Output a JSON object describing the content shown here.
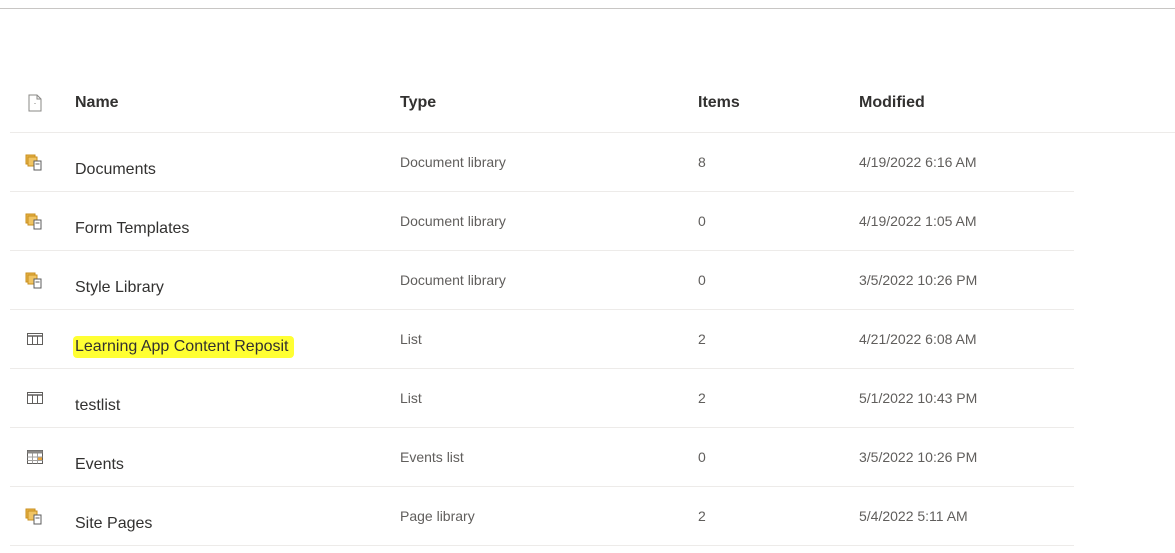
{
  "header": {
    "name": "Name",
    "type": "Type",
    "items": "Items",
    "modified": "Modified",
    "file_type_icon": "file-icon"
  },
  "rows": [
    {
      "icon": "document-library-icon",
      "name": "Documents",
      "type": "Document library",
      "items": "8",
      "modified": "4/19/2022 6:16 AM",
      "highlighted": false
    },
    {
      "icon": "document-library-icon",
      "name": "Form Templates",
      "type": "Document library",
      "items": "0",
      "modified": "4/19/2022 1:05 AM",
      "highlighted": false
    },
    {
      "icon": "document-library-icon",
      "name": "Style Library",
      "type": "Document library",
      "items": "0",
      "modified": "3/5/2022 10:26 PM",
      "highlighted": false
    },
    {
      "icon": "list-icon",
      "name": "Learning App Content Reposit",
      "type": "List",
      "items": "2",
      "modified": "4/21/2022 6:08 AM",
      "highlighted": true
    },
    {
      "icon": "list-icon",
      "name": "testlist",
      "type": "List",
      "items": "2",
      "modified": "5/1/2022 10:43 PM",
      "highlighted": false
    },
    {
      "icon": "events-list-icon",
      "name": "Events",
      "type": "Events list",
      "items": "0",
      "modified": "3/5/2022 10:26 PM",
      "highlighted": false
    },
    {
      "icon": "document-library-icon",
      "name": "Site Pages",
      "type": "Page library",
      "items": "2",
      "modified": "5/4/2022 5:11 AM",
      "highlighted": false
    }
  ],
  "colors": {
    "highlight": "#ffff33",
    "library_icon": "#d8a93c"
  }
}
